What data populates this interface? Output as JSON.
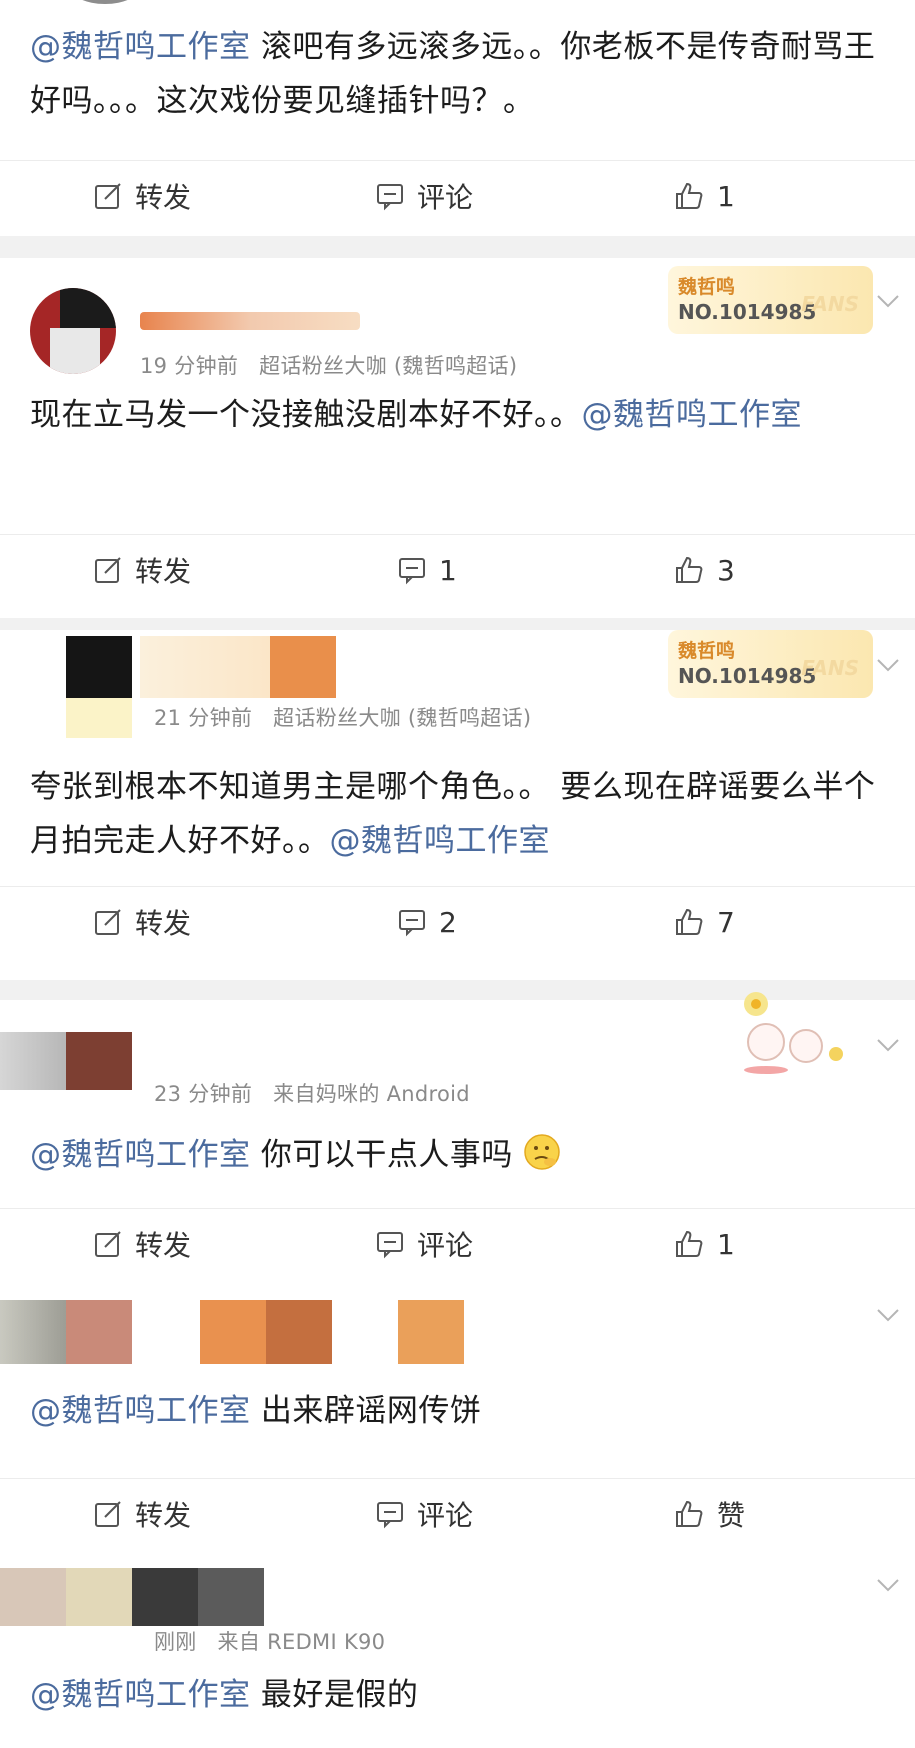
{
  "posts": [
    {
      "text_mention": "@魏哲鸣工作室",
      "text": " 滚吧有多远滚多远。。你老板不是传奇耐骂王好吗。。。这次戏份要见缝插针吗？。",
      "repost_label": "转发",
      "comment_label": "评论",
      "like_count": "1"
    },
    {
      "time": "19 分钟前",
      "source": "超话粉丝大咖 (魏哲鸣超话)",
      "badge_title": "魏哲鸣",
      "badge_no": "NO.1014985",
      "badge_fans": "FANS",
      "text": "现在立马发一个没接触没剧本好不好。。",
      "text_mention": "@魏哲鸣工作室",
      "repost_label": "转发",
      "comment_count": "1",
      "like_count": "3"
    },
    {
      "time": "21 分钟前",
      "source": "超话粉丝大咖 (魏哲鸣超话)",
      "badge_title": "魏哲鸣",
      "badge_no": "NO.1014985",
      "badge_fans": "FANS",
      "text": "夸张到根本不知道男主是哪个角色。。 要么现在辟谣要么半个月拍完走人好不好。。",
      "text_mention": "@魏哲鸣工作室",
      "repost_label": "转发",
      "comment_count": "2",
      "like_count": "7"
    },
    {
      "time": "23 分钟前",
      "source": "来自妈咪的 Android",
      "text_mention": "@魏哲鸣工作室",
      "text": " 你可以干点人事吗",
      "repost_label": "转发",
      "comment_label": "评论",
      "like_count": "1"
    },
    {
      "text_mention": "@魏哲鸣工作室",
      "text": " 出来辟谣网传饼",
      "repost_label": "转发",
      "comment_label": "评论",
      "like_label": "赞"
    },
    {
      "time": "刚刚",
      "source": "来自 REDMI K90",
      "text_mention": "@魏哲鸣工作室",
      "text": " 最好是假的"
    }
  ],
  "icons": {
    "repost": "repost-icon",
    "comment": "comment-icon",
    "like": "thumbs-up-icon",
    "more": "chevron-down-icon"
  },
  "colors": {
    "mention": "#4b6b9e",
    "meta": "#8a8a8a",
    "separator": "#f1f1f1"
  }
}
